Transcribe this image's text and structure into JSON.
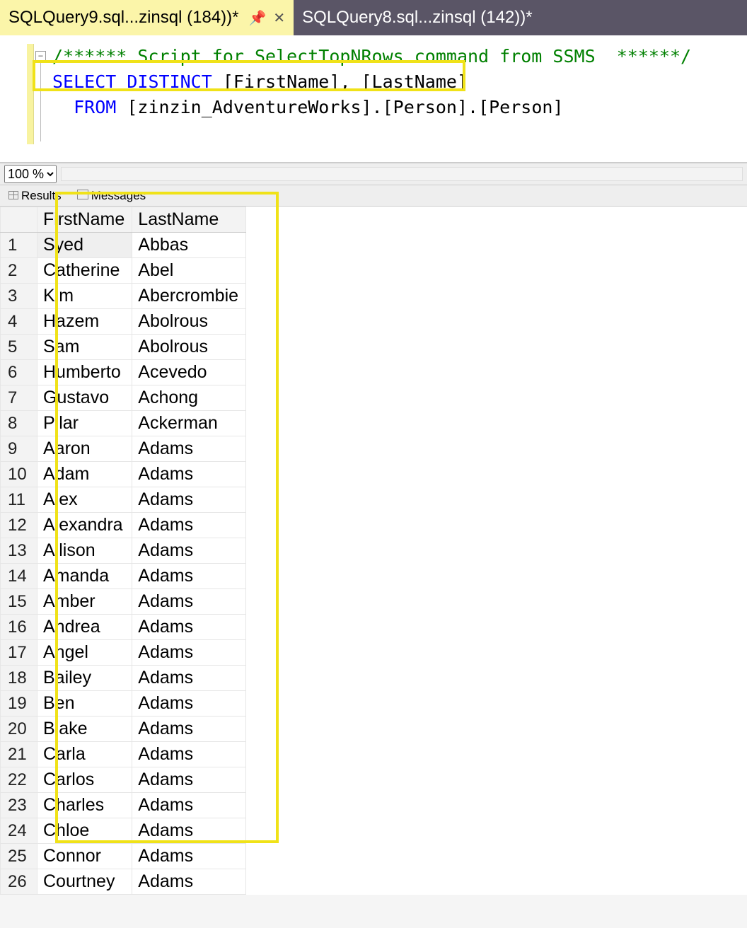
{
  "tabs": [
    {
      "label": "SQLQuery9.sql...zinsql (184))*",
      "active": true
    },
    {
      "label": "SQLQuery8.sql...zinsql (142))*",
      "active": false
    }
  ],
  "code": {
    "comment": "/****** Script for SelectTopNRows command from SSMS  ******/",
    "select_kw": "SELECT DISTINCT ",
    "select_cols": "[FirstName], [LastName]",
    "from_indent": "  ",
    "from_kw": "FROM ",
    "from_src": "[zinzin_AdventureWorks].[Person].[Person]"
  },
  "zoom": {
    "level": "100 %"
  },
  "result_tabs": {
    "results_label": "Results",
    "messages_label": "Messages"
  },
  "columns": [
    "FirstName",
    "LastName"
  ],
  "rows": [
    [
      "Syed",
      "Abbas"
    ],
    [
      "Catherine",
      "Abel"
    ],
    [
      "Kim",
      "Abercrombie"
    ],
    [
      "Hazem",
      "Abolrous"
    ],
    [
      "Sam",
      "Abolrous"
    ],
    [
      "Humberto",
      "Acevedo"
    ],
    [
      "Gustavo",
      "Achong"
    ],
    [
      "Pilar",
      "Ackerman"
    ],
    [
      "Aaron",
      "Adams"
    ],
    [
      "Adam",
      "Adams"
    ],
    [
      "Alex",
      "Adams"
    ],
    [
      "Alexandra",
      "Adams"
    ],
    [
      "Allison",
      "Adams"
    ],
    [
      "Amanda",
      "Adams"
    ],
    [
      "Amber",
      "Adams"
    ],
    [
      "Andrea",
      "Adams"
    ],
    [
      "Angel",
      "Adams"
    ],
    [
      "Bailey",
      "Adams"
    ],
    [
      "Ben",
      "Adams"
    ],
    [
      "Blake",
      "Adams"
    ],
    [
      "Carla",
      "Adams"
    ],
    [
      "Carlos",
      "Adams"
    ],
    [
      "Charles",
      "Adams"
    ],
    [
      "Chloe",
      "Adams"
    ],
    [
      "Connor",
      "Adams"
    ],
    [
      "Courtney",
      "Adams"
    ]
  ]
}
